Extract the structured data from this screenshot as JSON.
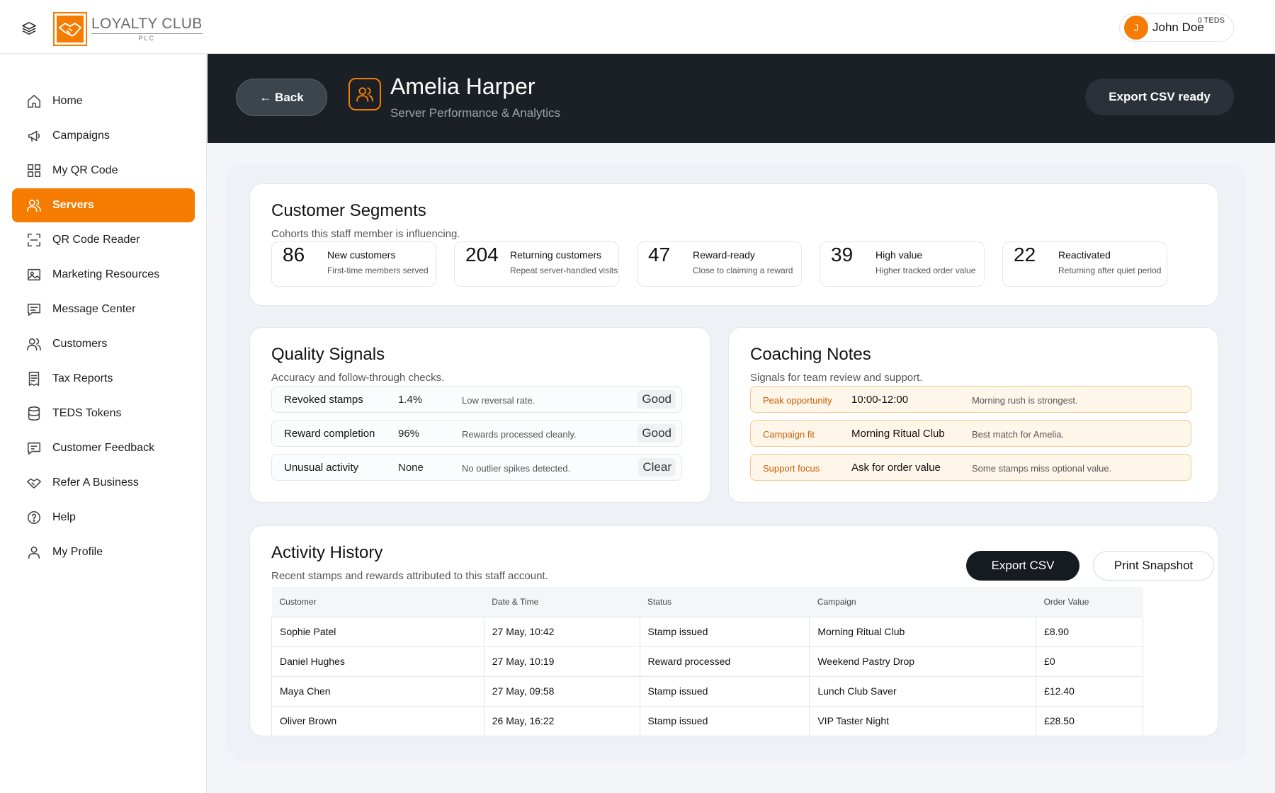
{
  "brand": {
    "title": "LOYALTY CLUB",
    "sub": "PLC"
  },
  "user": {
    "initial": "J",
    "name": "John Doe",
    "teds": "0 TEDS"
  },
  "nav": [
    {
      "label": "Home",
      "icon": "home-icon"
    },
    {
      "label": "Campaigns",
      "icon": "megaphone-icon"
    },
    {
      "label": "My QR Code",
      "icon": "qr-grid-icon"
    },
    {
      "label": "Servers",
      "icon": "users-icon",
      "active": true
    },
    {
      "label": "QR Code Reader",
      "icon": "scan-icon"
    },
    {
      "label": "Marketing Resources",
      "icon": "image-icon"
    },
    {
      "label": "Message Center",
      "icon": "message-icon"
    },
    {
      "label": "Customers",
      "icon": "customers-icon"
    },
    {
      "label": "Tax Reports",
      "icon": "receipt-icon"
    },
    {
      "label": "TEDS Tokens",
      "icon": "database-icon"
    },
    {
      "label": "Customer Feedback",
      "icon": "feedback-icon"
    },
    {
      "label": "Refer A Business",
      "icon": "handshake-icon"
    },
    {
      "label": "Help",
      "icon": "help-icon"
    },
    {
      "label": "My Profile",
      "icon": "profile-icon"
    }
  ],
  "hero": {
    "back": "← Back",
    "title": "Amelia Harper",
    "subtitle": "Server Performance & Analytics",
    "export_ready": "Export CSV ready"
  },
  "segments": {
    "title": "Customer Segments",
    "subtitle": "Cohorts this staff member is influencing.",
    "items": [
      {
        "num": "86",
        "label": "New customers",
        "desc": "First-time members served"
      },
      {
        "num": "204",
        "label": "Returning customers",
        "desc": "Repeat server-handled visits"
      },
      {
        "num": "47",
        "label": "Reward-ready",
        "desc": "Close to claiming a reward"
      },
      {
        "num": "39",
        "label": "High value",
        "desc": "Higher tracked order value"
      },
      {
        "num": "22",
        "label": "Reactivated",
        "desc": "Returning after quiet period"
      }
    ]
  },
  "quality": {
    "title": "Quality Signals",
    "subtitle": "Accuracy and follow-through checks.",
    "rows": [
      {
        "name": "Revoked stamps",
        "value": "1.4%",
        "desc": "Low reversal rate.",
        "badge": "Good"
      },
      {
        "name": "Reward completion",
        "value": "96%",
        "desc": "Rewards processed cleanly.",
        "badge": "Good"
      },
      {
        "name": "Unusual activity",
        "value": "None",
        "desc": "No outlier spikes detected.",
        "badge": "Clear"
      }
    ]
  },
  "coaching": {
    "title": "Coaching Notes",
    "subtitle": "Signals for team review and support.",
    "rows": [
      {
        "name": "Peak opportunity",
        "value": "10:00-12:00",
        "desc": "Morning rush is strongest."
      },
      {
        "name": "Campaign fit",
        "value": "Morning Ritual Club",
        "desc": "Best match for Amelia."
      },
      {
        "name": "Support focus",
        "value": "Ask for order value",
        "desc": "Some stamps miss optional value."
      }
    ]
  },
  "activity": {
    "title": "Activity History",
    "subtitle": "Recent stamps and rewards attributed to this staff account.",
    "export": "Export CSV",
    "print": "Print Snapshot",
    "columns": [
      "Customer",
      "Date & Time",
      "Status",
      "Campaign",
      "Order Value"
    ],
    "rows": [
      [
        "Sophie Patel",
        "27 May, 10:42",
        "Stamp issued",
        "Morning Ritual Club",
        "£8.90"
      ],
      [
        "Daniel Hughes",
        "27 May, 10:19",
        "Reward processed",
        "Weekend Pastry Drop",
        "£0"
      ],
      [
        "Maya Chen",
        "27 May, 09:58",
        "Stamp issued",
        "Lunch Club Saver",
        "£12.40"
      ],
      [
        "Oliver Brown",
        "26 May, 16:22",
        "Stamp issued",
        "VIP Taster Night",
        "£28.50"
      ]
    ]
  },
  "colors": {
    "accent": "#f57c00",
    "hero_bg": "#1a2026",
    "page_bg": "#f3f5f8"
  }
}
